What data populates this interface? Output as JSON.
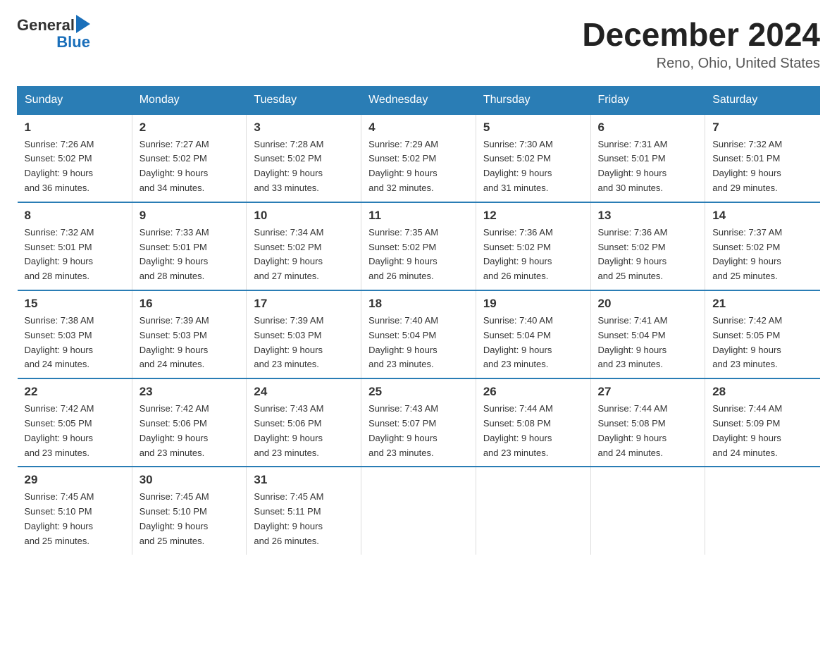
{
  "logo": {
    "text_general": "General",
    "text_blue": "Blue",
    "arrow": "▶"
  },
  "title": "December 2024",
  "location": "Reno, Ohio, United States",
  "days_of_week": [
    "Sunday",
    "Monday",
    "Tuesday",
    "Wednesday",
    "Thursday",
    "Friday",
    "Saturday"
  ],
  "weeks": [
    [
      {
        "num": "1",
        "sunrise": "7:26 AM",
        "sunset": "5:02 PM",
        "daylight": "9 hours and 36 minutes."
      },
      {
        "num": "2",
        "sunrise": "7:27 AM",
        "sunset": "5:02 PM",
        "daylight": "9 hours and 34 minutes."
      },
      {
        "num": "3",
        "sunrise": "7:28 AM",
        "sunset": "5:02 PM",
        "daylight": "9 hours and 33 minutes."
      },
      {
        "num": "4",
        "sunrise": "7:29 AM",
        "sunset": "5:02 PM",
        "daylight": "9 hours and 32 minutes."
      },
      {
        "num": "5",
        "sunrise": "7:30 AM",
        "sunset": "5:02 PM",
        "daylight": "9 hours and 31 minutes."
      },
      {
        "num": "6",
        "sunrise": "7:31 AM",
        "sunset": "5:01 PM",
        "daylight": "9 hours and 30 minutes."
      },
      {
        "num": "7",
        "sunrise": "7:32 AM",
        "sunset": "5:01 PM",
        "daylight": "9 hours and 29 minutes."
      }
    ],
    [
      {
        "num": "8",
        "sunrise": "7:32 AM",
        "sunset": "5:01 PM",
        "daylight": "9 hours and 28 minutes."
      },
      {
        "num": "9",
        "sunrise": "7:33 AM",
        "sunset": "5:01 PM",
        "daylight": "9 hours and 28 minutes."
      },
      {
        "num": "10",
        "sunrise": "7:34 AM",
        "sunset": "5:02 PM",
        "daylight": "9 hours and 27 minutes."
      },
      {
        "num": "11",
        "sunrise": "7:35 AM",
        "sunset": "5:02 PM",
        "daylight": "9 hours and 26 minutes."
      },
      {
        "num": "12",
        "sunrise": "7:36 AM",
        "sunset": "5:02 PM",
        "daylight": "9 hours and 26 minutes."
      },
      {
        "num": "13",
        "sunrise": "7:36 AM",
        "sunset": "5:02 PM",
        "daylight": "9 hours and 25 minutes."
      },
      {
        "num": "14",
        "sunrise": "7:37 AM",
        "sunset": "5:02 PM",
        "daylight": "9 hours and 25 minutes."
      }
    ],
    [
      {
        "num": "15",
        "sunrise": "7:38 AM",
        "sunset": "5:03 PM",
        "daylight": "9 hours and 24 minutes."
      },
      {
        "num": "16",
        "sunrise": "7:39 AM",
        "sunset": "5:03 PM",
        "daylight": "9 hours and 24 minutes."
      },
      {
        "num": "17",
        "sunrise": "7:39 AM",
        "sunset": "5:03 PM",
        "daylight": "9 hours and 23 minutes."
      },
      {
        "num": "18",
        "sunrise": "7:40 AM",
        "sunset": "5:04 PM",
        "daylight": "9 hours and 23 minutes."
      },
      {
        "num": "19",
        "sunrise": "7:40 AM",
        "sunset": "5:04 PM",
        "daylight": "9 hours and 23 minutes."
      },
      {
        "num": "20",
        "sunrise": "7:41 AM",
        "sunset": "5:04 PM",
        "daylight": "9 hours and 23 minutes."
      },
      {
        "num": "21",
        "sunrise": "7:42 AM",
        "sunset": "5:05 PM",
        "daylight": "9 hours and 23 minutes."
      }
    ],
    [
      {
        "num": "22",
        "sunrise": "7:42 AM",
        "sunset": "5:05 PM",
        "daylight": "9 hours and 23 minutes."
      },
      {
        "num": "23",
        "sunrise": "7:42 AM",
        "sunset": "5:06 PM",
        "daylight": "9 hours and 23 minutes."
      },
      {
        "num": "24",
        "sunrise": "7:43 AM",
        "sunset": "5:06 PM",
        "daylight": "9 hours and 23 minutes."
      },
      {
        "num": "25",
        "sunrise": "7:43 AM",
        "sunset": "5:07 PM",
        "daylight": "9 hours and 23 minutes."
      },
      {
        "num": "26",
        "sunrise": "7:44 AM",
        "sunset": "5:08 PM",
        "daylight": "9 hours and 23 minutes."
      },
      {
        "num": "27",
        "sunrise": "7:44 AM",
        "sunset": "5:08 PM",
        "daylight": "9 hours and 24 minutes."
      },
      {
        "num": "28",
        "sunrise": "7:44 AM",
        "sunset": "5:09 PM",
        "daylight": "9 hours and 24 minutes."
      }
    ],
    [
      {
        "num": "29",
        "sunrise": "7:45 AM",
        "sunset": "5:10 PM",
        "daylight": "9 hours and 25 minutes."
      },
      {
        "num": "30",
        "sunrise": "7:45 AM",
        "sunset": "5:10 PM",
        "daylight": "9 hours and 25 minutes."
      },
      {
        "num": "31",
        "sunrise": "7:45 AM",
        "sunset": "5:11 PM",
        "daylight": "9 hours and 26 minutes."
      },
      null,
      null,
      null,
      null
    ]
  ]
}
